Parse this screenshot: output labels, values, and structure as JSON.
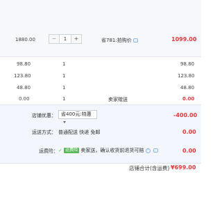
{
  "main_item": {
    "unit_price": "1880.00",
    "quantity": "1",
    "minus_label": "−",
    "plus_label": "+",
    "offer_text": "省781:拍购价",
    "subtotal": "1099.00"
  },
  "extra_items": [
    {
      "unit_price": "98.80",
      "quantity": "1",
      "note": "",
      "subtotal": "98.80"
    },
    {
      "unit_price": "123.80",
      "quantity": "1",
      "note": "",
      "subtotal": "123.80"
    },
    {
      "unit_price": "48.80",
      "quantity": "1",
      "note": "",
      "subtotal": "48.80"
    },
    {
      "unit_price": "0.00",
      "quantity": "1",
      "note": "卖家赠送",
      "subtotal": "0.00"
    }
  ],
  "shop": {
    "discount": {
      "label": "店铺优惠：",
      "selected": "省400元:特惠",
      "value": "-400.00"
    },
    "shipping": {
      "label": "运送方式：",
      "method": "普通配送 快递 免邮",
      "value": "0.00"
    },
    "insurance": {
      "label": "运费险：",
      "badge": "运费险",
      "text": "卖家送，确认收货前退货可赔",
      "value": "0.00"
    }
  },
  "total": {
    "label": "店铺合计(含运费)",
    "value": "¥699.00"
  },
  "colors": {
    "price_red": "#e4393c",
    "check_green": "#6bb34a",
    "link_blue": "#8fb5e3"
  }
}
